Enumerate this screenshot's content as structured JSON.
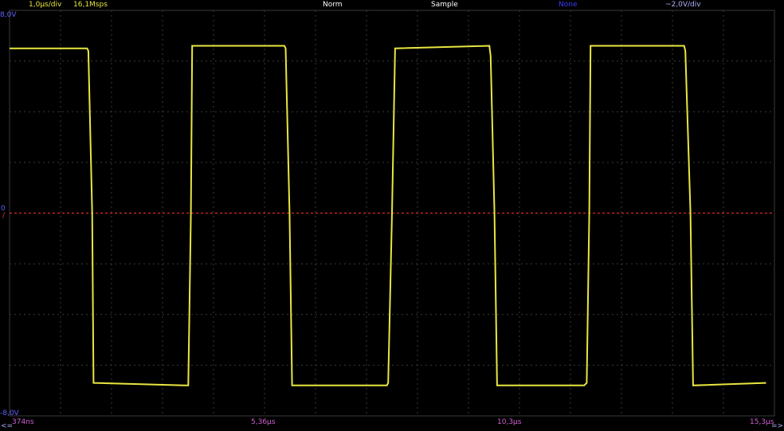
{
  "header": {
    "timebase": "1,0µs/div",
    "sample_rate": "16,1Msps",
    "trigger_mode": "Norm",
    "acquisition": "Sample",
    "math": "None",
    "channel_scale": "~2,0V/div"
  },
  "voltage_labels": {
    "top": "8,0V",
    "zero": "0",
    "bottom": "-8,0V"
  },
  "trigger_marker": "/",
  "time_labels": {
    "start": "374ns",
    "mid1": "5,36µs",
    "mid2": "10,3µs",
    "end": "15,3µs"
  },
  "scroll": {
    "left": "<=",
    "right": "=>"
  },
  "colors": {
    "background": "#000000",
    "grid": "#3a3a3a",
    "trace": "#e8e640",
    "header_text": "#e8e640",
    "mode_text": "#ffffff",
    "math_text": "#3a3aff",
    "scale_text": "#b0b0ff",
    "time_text": "#d060d0",
    "ref_label": "#6060ff",
    "trigger_line": "#ff3030"
  },
  "chart_data": {
    "type": "line",
    "title": "",
    "xlabel": "",
    "ylabel": "",
    "xlim": [
      0.374,
      15.3
    ],
    "ylim": [
      -8.0,
      8.0
    ],
    "grid": true,
    "trigger_level": 0,
    "series": [
      {
        "x": [
          0.374,
          3.4,
          3.45,
          3.6,
          3.65,
          7.2,
          7.35,
          7.45,
          7.5,
          11.1,
          11.15,
          11.3,
          11.4,
          15.1,
          15.15,
          15.3,
          15.42,
          19.1,
          19.15,
          19.3,
          19.4,
          22.8,
          22.9,
          23.0,
          23.05,
          26.7,
          26.75,
          26.95,
          27.05,
          29.9
        ],
        "y": [
          6.5,
          6.5,
          6.4,
          0,
          -6.7,
          -6.8,
          -6.8,
          0,
          6.6,
          6.6,
          6.5,
          0,
          -6.8,
          -6.8,
          -6.7,
          0,
          6.5,
          6.6,
          6.2,
          0,
          -6.8,
          -6.8,
          -6.7,
          0,
          6.6,
          6.6,
          6.4,
          0,
          -6.8,
          -6.7
        ]
      }
    ]
  }
}
